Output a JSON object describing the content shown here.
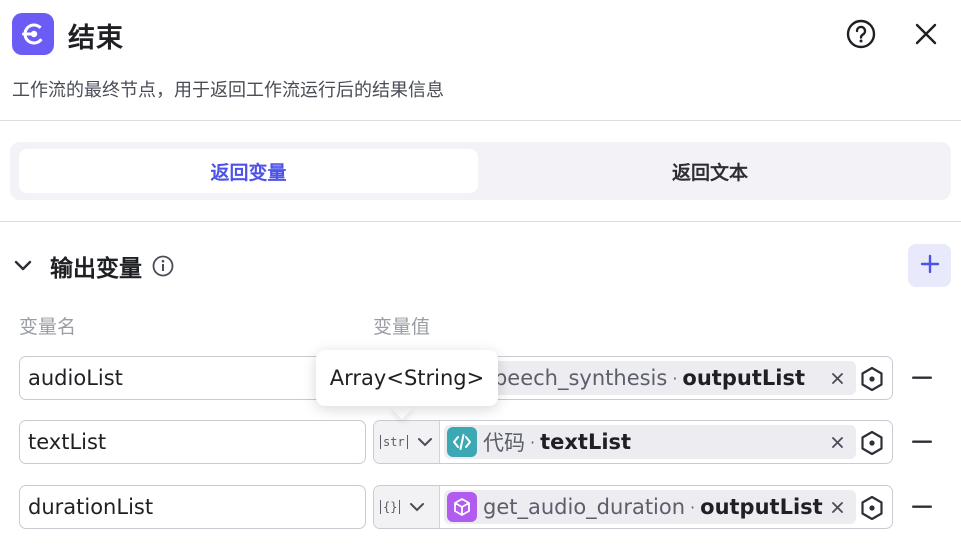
{
  "header": {
    "title": "结束",
    "description": "工作流的最终节点，用于返回工作流运行后的结果信息",
    "node_icon": "exit-icon",
    "help_icon": "question-circle-icon",
    "close_icon": "close-icon"
  },
  "tabs": [
    {
      "label": "返回变量",
      "active": true
    },
    {
      "label": "返回文本",
      "active": false
    }
  ],
  "output_section": {
    "title": "输出变量",
    "add_icon": "plus-icon"
  },
  "columns": {
    "name": "变量名",
    "value": "变量值"
  },
  "rows": [
    {
      "name": "audioList",
      "type_tag": "str",
      "ref_node": "speech_synthesis",
      "ref_field": "outputList",
      "node_icon": "tts-node-icon"
    },
    {
      "name": "textList",
      "type_tag": "str",
      "ref_node": "代码",
      "ref_field": "textList",
      "node_icon": "code-icon"
    },
    {
      "name": "durationList",
      "type_tag": "{}",
      "ref_node": "get_audio_duration",
      "ref_field": "outputList",
      "node_icon": "plugin-cube-icon"
    }
  ],
  "tooltip": {
    "text": "Array<String>"
  },
  "colors": {
    "accent": "#4d53e8",
    "node_icon_bg": "#6b5cf6",
    "code_icon_bg": "#3ca8b3",
    "plugin_icon_bg": "#b15cf0"
  }
}
